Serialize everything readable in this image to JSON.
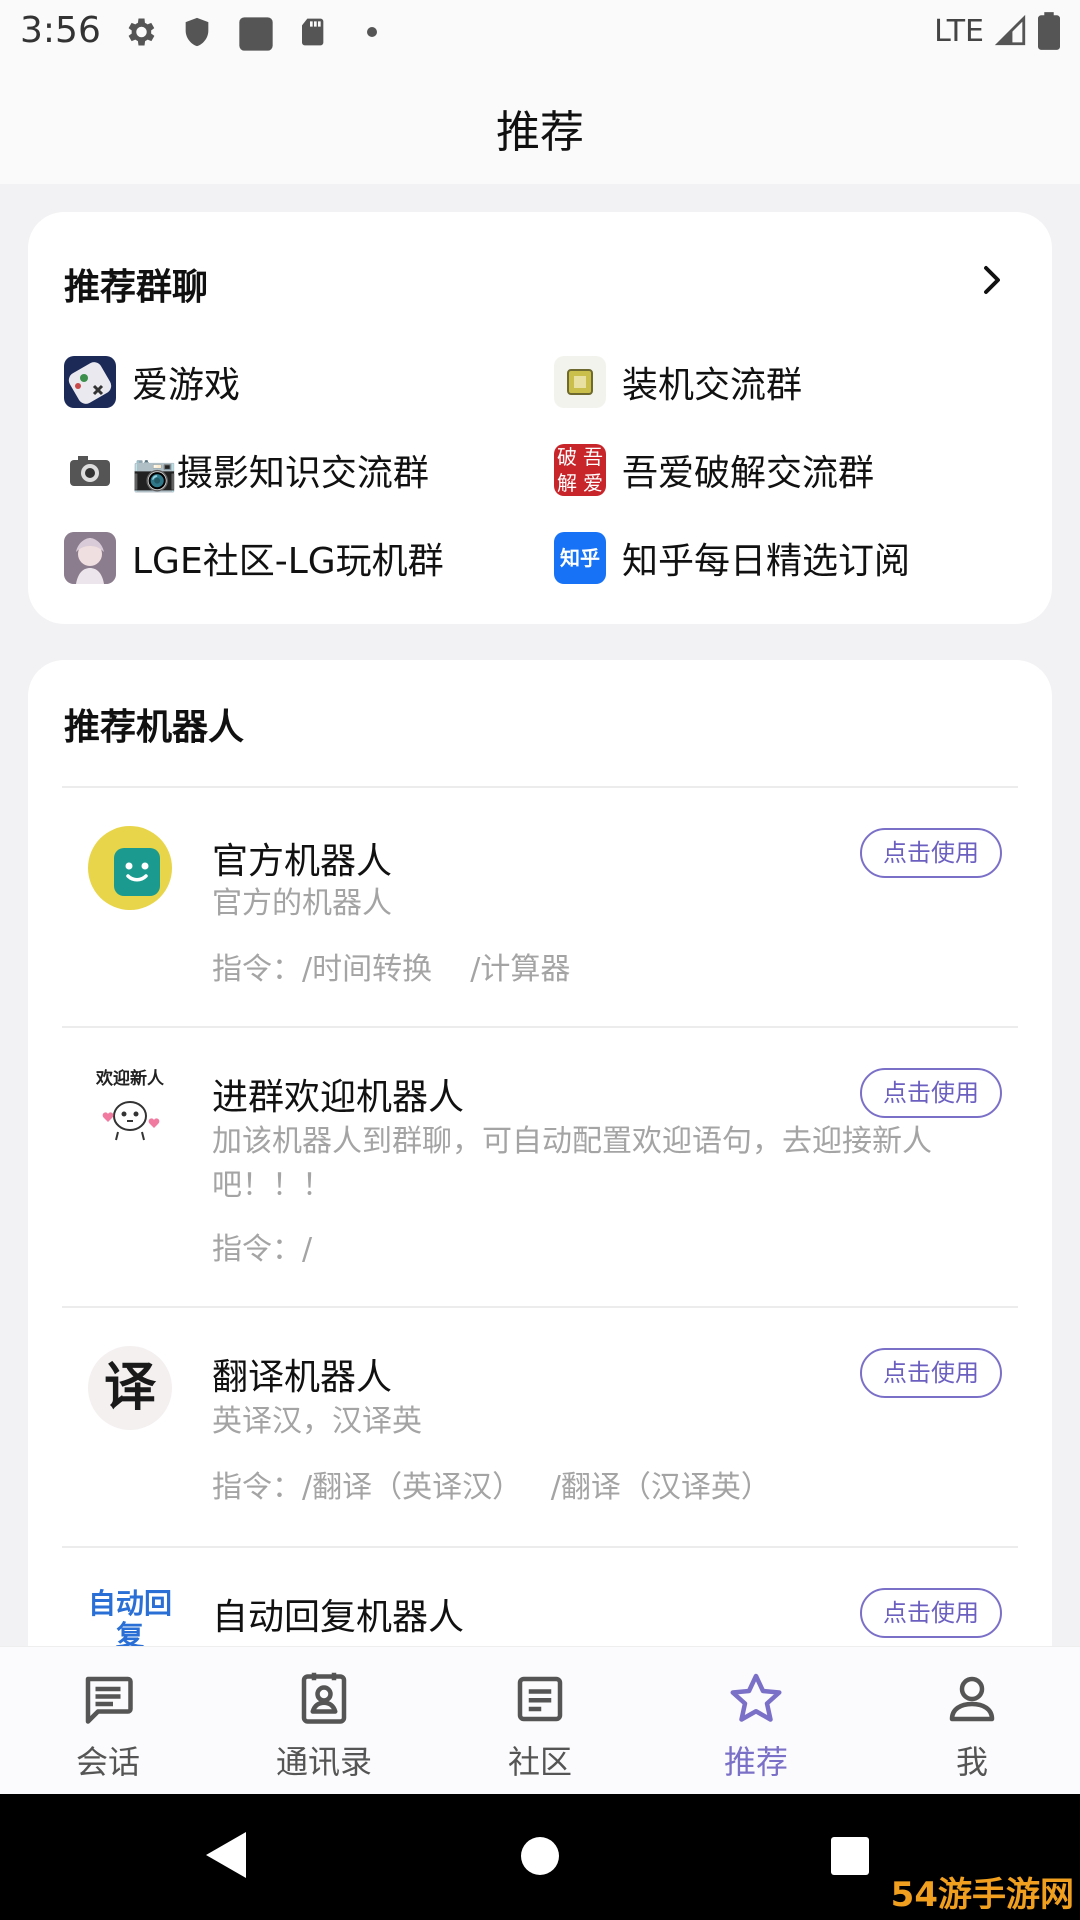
{
  "status_bar": {
    "time": "3:56",
    "network": "LTE"
  },
  "header": {
    "title": "推荐"
  },
  "groups": {
    "title": "推荐群聊",
    "items": [
      {
        "label": "爱游戏",
        "icon": "gamepad-icon"
      },
      {
        "label": "装机交流群",
        "icon": "cpu-icon"
      },
      {
        "label": "📷摄影知识交流群",
        "icon": "camera-icon"
      },
      {
        "label": "吾爱破解交流群",
        "icon": "crack-logo-icon"
      },
      {
        "label": "LGE社区-LG玩机群",
        "icon": "anime-avatar-icon"
      },
      {
        "label": "知乎每日精选订阅",
        "icon": "zhihu-icon"
      }
    ],
    "crack_logo_text": [
      "破",
      "吾",
      "解",
      "爱"
    ],
    "zhihu_text": "知乎"
  },
  "bots": {
    "title": "推荐机器人",
    "use_label": "点击使用",
    "items": [
      {
        "name": "官方机器人",
        "desc": "官方的机器人",
        "cmd": "指令：/时间转换    /计算器"
      },
      {
        "name": "进群欢迎机器人",
        "desc": "加该机器人到群聊，可自动配置欢迎语句，去迎接新人吧！！！",
        "cmd": "指令：/",
        "avatar_text": "欢迎新人"
      },
      {
        "name": "翻译机器人",
        "desc": "英译汉，汉译英",
        "cmd": "指令：/翻译（英译汉）   /翻译（汉译英）",
        "avatar_text": "译"
      },
      {
        "name": "自动回复机器人",
        "avatar_text": "自动回复"
      }
    ]
  },
  "bottom_nav": {
    "items": [
      {
        "label": "会话",
        "icon": "chat-icon"
      },
      {
        "label": "通讯录",
        "icon": "contacts-icon"
      },
      {
        "label": "社区",
        "icon": "community-icon"
      },
      {
        "label": "推荐",
        "icon": "star-icon",
        "active": true
      },
      {
        "label": "我",
        "icon": "profile-icon"
      }
    ]
  },
  "colors": {
    "accent": "#7b70c8",
    "official_bot_bg": "#e8d54a",
    "official_bot_face": "#1b9b8f"
  },
  "watermark": "54游手游网"
}
